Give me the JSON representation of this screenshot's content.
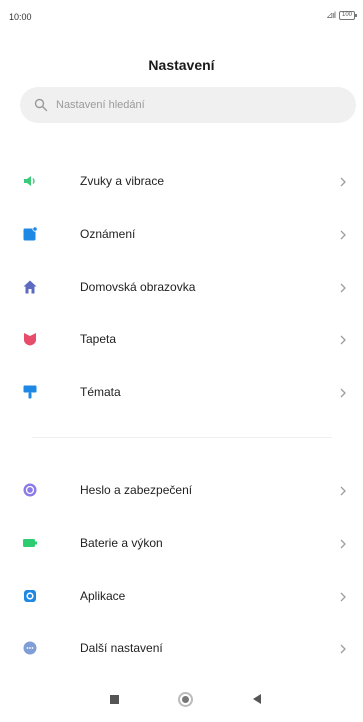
{
  "status_bar": {
    "time": "10:00",
    "signal": "⊿ıl",
    "battery": "100"
  },
  "header": {
    "title": "Nastavení"
  },
  "search": {
    "placeholder": "Nastavení hledání"
  },
  "group_1": [
    {
      "label": "Zvuky a vibrace",
      "icon": "speaker-icon",
      "color": "#3dc97a"
    },
    {
      "label": "Oznámení",
      "icon": "notification-icon",
      "color": "#1e88e5"
    },
    {
      "label": "Domovská obrazovka",
      "icon": "home-icon",
      "color": "#5c6bc0"
    },
    {
      "label": "Tapeta",
      "icon": "wallpaper-icon",
      "color": "#e74c6b"
    },
    {
      "label": "Témata",
      "icon": "themes-icon",
      "color": "#1e88e5"
    }
  ],
  "group_2": [
    {
      "label": "Heslo a zabezpečení",
      "icon": "lock-icon",
      "color": "#8c7ae6"
    },
    {
      "label": "Baterie a výkon",
      "icon": "battery-icon",
      "color": "#2ecc71"
    },
    {
      "label": "Aplikace",
      "icon": "gear-icon",
      "color": "#1e88e5"
    },
    {
      "label": "Další nastavení",
      "icon": "more-icon",
      "color": "#7f9ed8"
    }
  ],
  "nav": {
    "recents": "recents-icon",
    "home": "home-button-icon",
    "back": "back-icon"
  }
}
